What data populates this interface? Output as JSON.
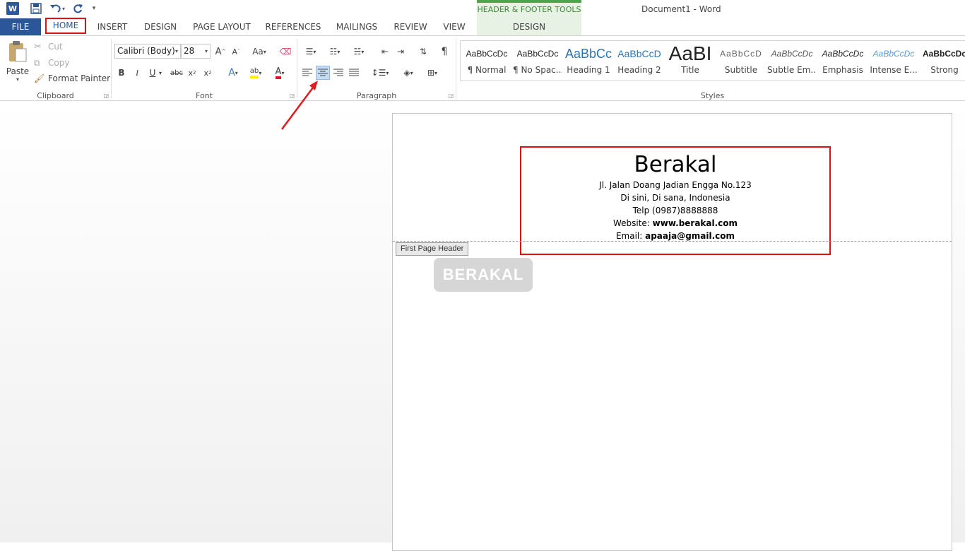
{
  "window": {
    "title": "Document1 - Word"
  },
  "tabs": [
    {
      "label": "FILE"
    },
    {
      "label": "HOME"
    },
    {
      "label": "INSERT"
    },
    {
      "label": "DESIGN"
    },
    {
      "label": "PAGE LAYOUT"
    },
    {
      "label": "REFERENCES"
    },
    {
      "label": "MAILINGS"
    },
    {
      "label": "REVIEW"
    },
    {
      "label": "VIEW"
    },
    {
      "label": "DESIGN"
    }
  ],
  "contextual_tab": {
    "group": "HEADER & FOOTER TOOLS",
    "color": "#4ea44a"
  },
  "clipboard": {
    "paste": "Paste",
    "cut": "Cut",
    "copy": "Copy",
    "format_painter": "Format Painter",
    "label": "Clipboard"
  },
  "font": {
    "name": "Calibri (Body)",
    "size": "28",
    "label": "Font"
  },
  "paragraph": {
    "label": "Paragraph",
    "active_alignment": "center"
  },
  "styles": {
    "label": "Styles",
    "items": [
      {
        "sample": "AaBbCcDc",
        "name": "¶ Normal"
      },
      {
        "sample": "AaBbCcDc",
        "name": "¶ No Spac..."
      },
      {
        "sample": "AaBbCc",
        "name": "Heading 1"
      },
      {
        "sample": "AaBbCcD",
        "name": "Heading 2"
      },
      {
        "sample": "AaBI",
        "name": "Title"
      },
      {
        "sample": "AaBbCcD",
        "name": "Subtitle"
      },
      {
        "sample": "AaBbCcDc",
        "name": "Subtle Em..."
      },
      {
        "sample": "AaBbCcDc",
        "name": "Emphasis"
      },
      {
        "sample": "AaBbCcDc",
        "name": "Intense E..."
      },
      {
        "sample": "AaBbCcDc",
        "name": "Strong"
      }
    ]
  },
  "document": {
    "header_tag": "First Page Header",
    "header_title": "Berakal",
    "address1": "Jl. Jalan Doang Jadian Engga No.123",
    "address2": "Di sini, Di sana, Indonesia",
    "phone": "Telp (0987)8888888",
    "website_label": "Website: ",
    "website": "www.berakal.com",
    "email_label": "Email: ",
    "email": "apaaja@gmail.com"
  },
  "watermark": "BERAKAL",
  "colors": {
    "accent": "#2b579a",
    "highlight": "#dd1111"
  }
}
